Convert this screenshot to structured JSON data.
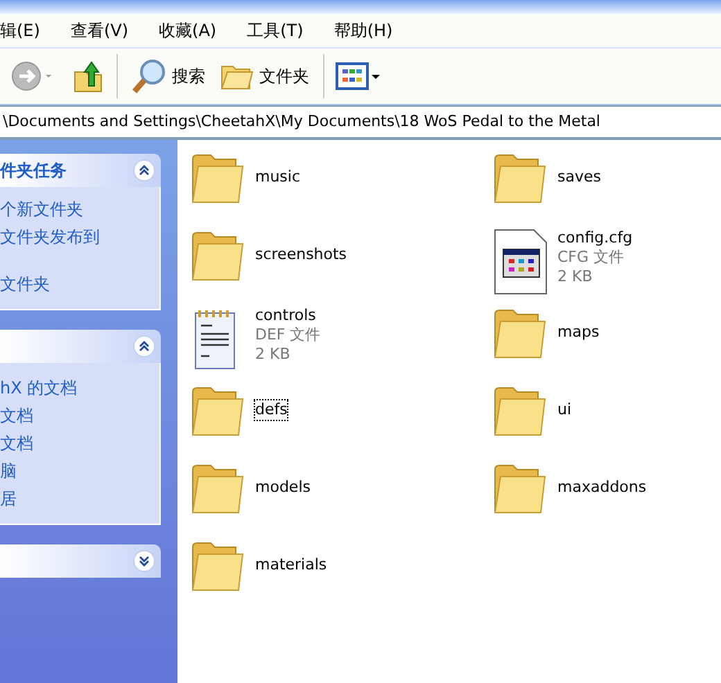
{
  "menu": [
    {
      "label": "辑(E)"
    },
    {
      "label": "查看(V)"
    },
    {
      "label": "收藏(A)"
    },
    {
      "label": "工具(T)"
    },
    {
      "label": "帮助(H)"
    }
  ],
  "toolbar": {
    "search": "搜索",
    "folders": "文件夹"
  },
  "address": "\\Documents and Settings\\CheetahX\\My Documents\\18 WoS Pedal to the Metal",
  "panels": [
    {
      "title": "件夹任务",
      "expanded": true,
      "items": [
        {
          "label": "个新文件夹"
        },
        {
          "label": "文件夹发布到"
        },
        {
          "label": "文件夹"
        }
      ]
    },
    {
      "expanded": true,
      "items": [
        {
          "label": "hX 的文档"
        },
        {
          "label": "文档"
        },
        {
          "label": "文档"
        },
        {
          "label": "脑"
        },
        {
          "label": "居"
        }
      ]
    },
    {
      "expanded": false
    }
  ],
  "files": [
    {
      "kind": "folder",
      "name": "music",
      "focused": false
    },
    {
      "kind": "folder",
      "name": "screenshots",
      "focused": false
    },
    {
      "kind": "def",
      "name": "controls",
      "type": "DEF 文件",
      "size": "2 KB",
      "focused": false
    },
    {
      "kind": "folder",
      "name": "defs",
      "focused": true
    },
    {
      "kind": "folder",
      "name": "models",
      "focused": false
    },
    {
      "kind": "folder",
      "name": "materials",
      "focused": false
    },
    {
      "kind": "folder",
      "name": "saves",
      "focused": false
    },
    {
      "kind": "cfg",
      "name": "config.cfg",
      "type": "CFG 文件",
      "size": "2 KB",
      "focused": false
    },
    {
      "kind": "folder",
      "name": "maps",
      "focused": false
    },
    {
      "kind": "folder",
      "name": "ui",
      "focused": false
    },
    {
      "kind": "folder",
      "name": "maxaddons",
      "focused": false
    }
  ]
}
